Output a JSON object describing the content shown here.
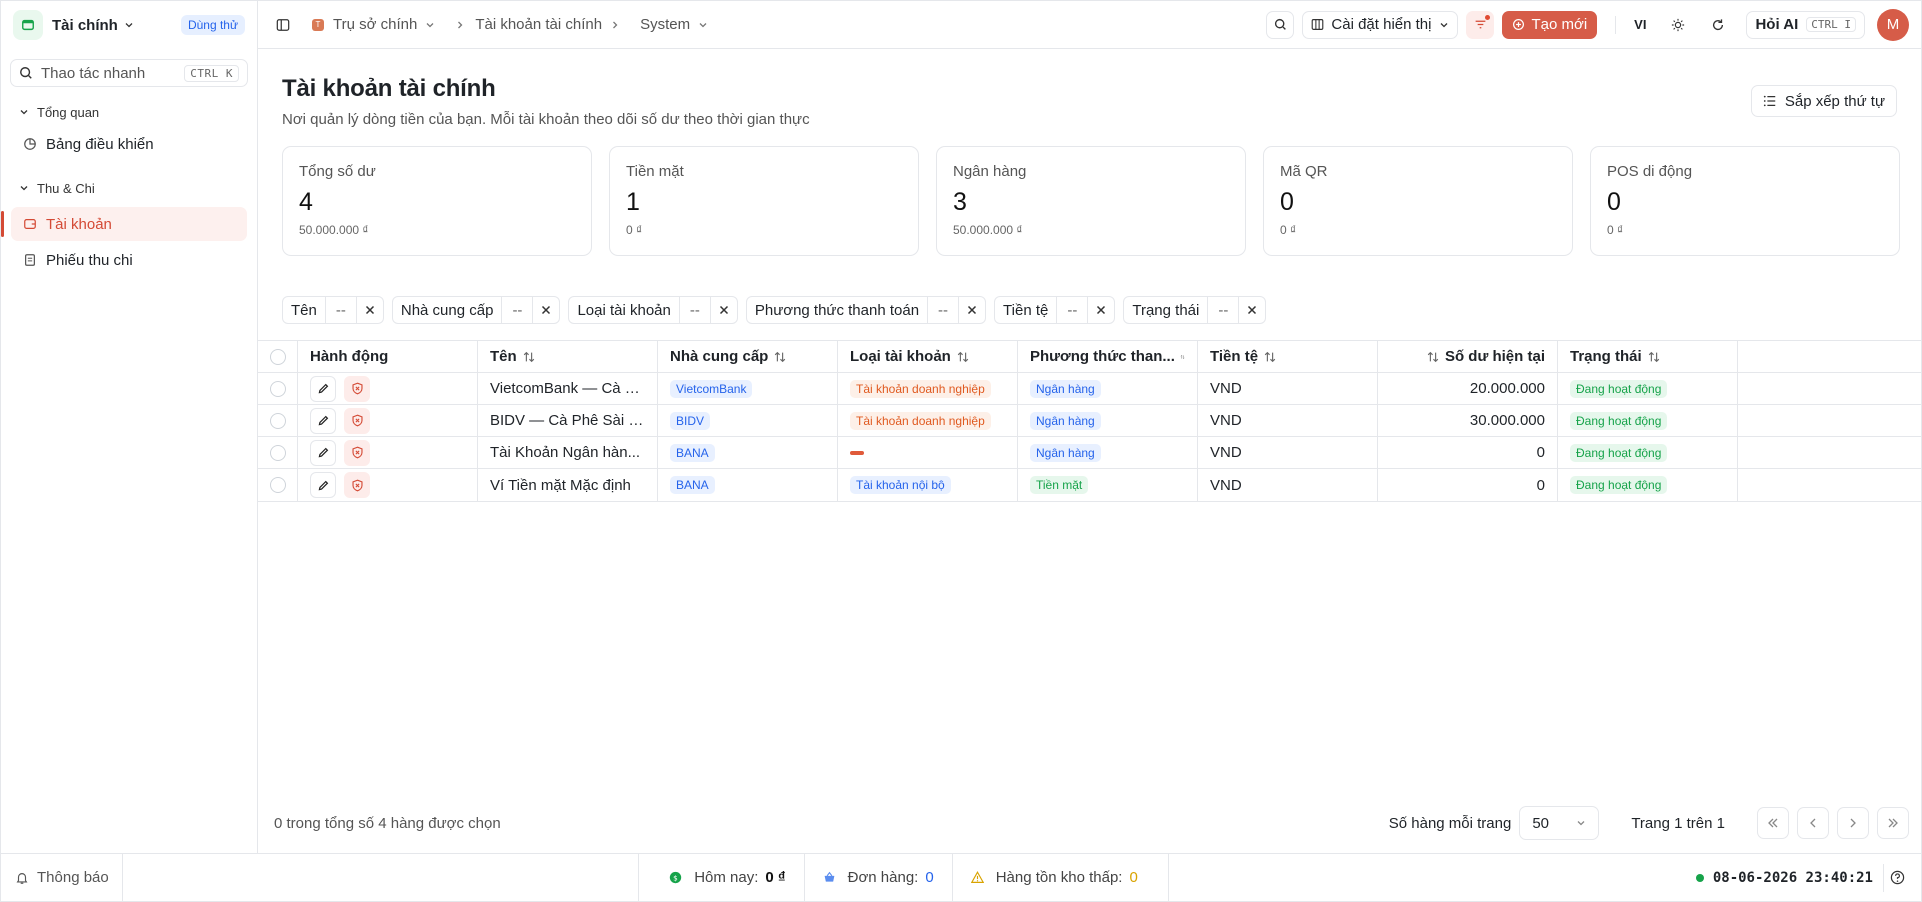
{
  "sidebar": {
    "app_name": "Tài chính",
    "trial_badge": "Dùng thử",
    "quick_action": {
      "placeholder": "Thao tác nhanh",
      "shortcut": "CTRL K"
    },
    "sections": [
      {
        "label": "Tổng quan",
        "items": [
          {
            "label": "Bảng điều khiển",
            "icon": "pie-chart-icon"
          }
        ]
      },
      {
        "label": "Thu & Chi",
        "items": [
          {
            "label": "Tài khoản",
            "icon": "wallet-icon",
            "active": true
          },
          {
            "label": "Phiếu thu chi",
            "icon": "document-icon"
          }
        ]
      }
    ]
  },
  "topbar": {
    "breadcrumb": {
      "org": "Trụ sở chính",
      "org_badge": "T",
      "page": "Tài khoản tài chính",
      "view": "System"
    },
    "display_settings": "Cài đặt hiển thị",
    "create_new": "Tạo mới",
    "language": "VI",
    "ask_ai": "Hỏi AI",
    "ask_ai_shortcut": "CTRL I",
    "avatar_initial": "M"
  },
  "page": {
    "title": "Tài khoản tài chính",
    "subtitle": "Nơi quản lý dòng tiền của bạn. Mỗi tài khoản theo dõi số dư theo thời gian thực",
    "sort_button": "Sắp xếp thứ tự"
  },
  "cards": [
    {
      "label": "Tổng số dư",
      "count": "4",
      "amount": "50.000.000 ₫"
    },
    {
      "label": "Tiền mặt",
      "count": "1",
      "amount": "0 ₫"
    },
    {
      "label": "Ngân hàng",
      "count": "3",
      "amount": "50.000.000 ₫"
    },
    {
      "label": "Mã QR",
      "count": "0",
      "amount": "0 ₫"
    },
    {
      "label": "POS di động",
      "count": "0",
      "amount": "0 ₫"
    }
  ],
  "filters": [
    {
      "label": "Tên",
      "value": "--"
    },
    {
      "label": "Nhà cung cấp",
      "value": "--"
    },
    {
      "label": "Loại tài khoản",
      "value": "--"
    },
    {
      "label": "Phương thức thanh toán",
      "value": "--"
    },
    {
      "label": "Tiền tệ",
      "value": "--"
    },
    {
      "label": "Trạng thái",
      "value": "--"
    }
  ],
  "table": {
    "columns": {
      "actions": "Hành động",
      "name": "Tên",
      "provider": "Nhà cung cấp",
      "account_type": "Loại tài khoản",
      "payment_method": "Phương thức than...",
      "currency": "Tiền tệ",
      "balance": "Số dư hiện tại",
      "status": "Trạng thái"
    },
    "rows": [
      {
        "name": "VietcomBank — Cà P...",
        "provider": "VietcomBank",
        "account_type": "Tài khoản doanh nghiệp",
        "account_type_color": "orange",
        "payment_method": "Ngân hàng",
        "payment_color": "blue",
        "currency": "VND",
        "balance": "20.000.000",
        "status": "Đang hoạt động"
      },
      {
        "name": "BIDV — Cà Phê Sài G...",
        "provider": "BIDV",
        "account_type": "Tài khoản doanh nghiệp",
        "account_type_color": "orange",
        "payment_method": "Ngân hàng",
        "payment_color": "blue",
        "currency": "VND",
        "balance": "30.000.000",
        "status": "Đang hoạt động"
      },
      {
        "name": "Tài Khoản Ngân hàn...",
        "provider": "BANA",
        "account_type": "",
        "account_type_color": "dash",
        "payment_method": "Ngân hàng",
        "payment_color": "blue",
        "currency": "VND",
        "balance": "0",
        "status": "Đang hoạt động"
      },
      {
        "name": "Ví Tiền mặt Mặc định",
        "provider": "BANA",
        "account_type": "Tài khoản nội bộ",
        "account_type_color": "blue",
        "payment_method": "Tiền mặt",
        "payment_color": "green",
        "currency": "VND",
        "balance": "0",
        "status": "Đang hoạt động"
      }
    ],
    "selection_summary": "0 trong tổng số 4 hàng được chọn",
    "rows_per_page_label": "Số hàng mỗi trang",
    "rows_per_page": "50",
    "page_info": "Trang 1 trên 1"
  },
  "statusbar": {
    "notifications": "Thông báo",
    "today_label": "Hôm nay:",
    "today_value": "0 ₫",
    "orders_label": "Đơn hàng:",
    "orders_value": "0",
    "low_stock_label": "Hàng tồn kho thấp:",
    "low_stock_value": "0",
    "datetime": "08-06-2026 23:40:21"
  },
  "colors": {
    "accent": "#d65c48",
    "success": "#16a34a",
    "info": "#2563eb",
    "warning": "#d9a300"
  }
}
